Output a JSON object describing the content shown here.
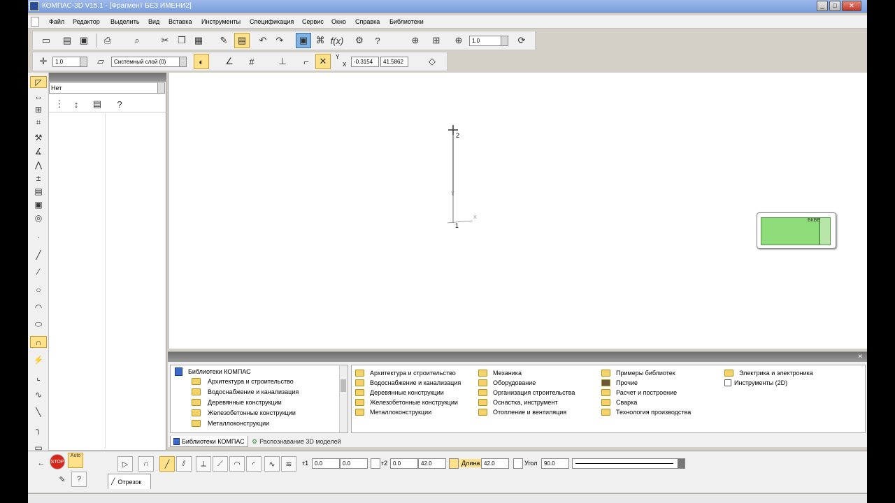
{
  "window": {
    "title": "КОМПАС-3D V15.1 - [Фрагмент БЕЗ ИМЕНИ2]",
    "buttons": [
      "_",
      "□",
      "✕"
    ]
  },
  "menubar": {
    "items": [
      "Файл",
      "Редактор",
      "Выделить",
      "Вид",
      "Вставка",
      "Инструменты",
      "Спецификация",
      "Сервис",
      "Окно",
      "Справка",
      "Библиотеки"
    ]
  },
  "toolbar_standard": {
    "scale_value": "1.0"
  },
  "toolbar_current_state": {
    "step_value": "1.0",
    "layer": "Системный слой (0)",
    "coord_x": "-0.3154",
    "coord_y": "41.5862",
    "coord_label_y": "Y",
    "coord_label_x": "X"
  },
  "tree_panel": {
    "filter": "Нет"
  },
  "canvas": {
    "point_1": "1",
    "point_2": "2",
    "axis_x": "X",
    "axis_y": "Y",
    "nav_label": "БКВЕ"
  },
  "library_panel": {
    "root": "Библиотеки КОМПАС",
    "tree_items": [
      "Архитектура и строительство",
      "Водоснабжение и канализация",
      "Деревянные конструкции",
      "Железобетонные конструкции",
      "Металлоконструкции"
    ],
    "columns": [
      [
        "Архитектура и строительство",
        "Водоснабжение и канализация",
        "Деревянные конструкции",
        "Железобетонные конструкции",
        "Металлоконструкции"
      ],
      [
        "Механика",
        "Оборудование",
        "Организация строительства",
        "Оснастка, инструмент",
        "Отопление и вентиляция"
      ],
      [
        "Примеры библиотек",
        "Прочие",
        "Расчет и построение",
        "Сварка",
        "Технология производства"
      ],
      [
        "Электрика и электроника",
        "Инструменты (2D)"
      ]
    ],
    "tabs": [
      "Библиотеки КОМПАС",
      "Распознавание 3D моделей"
    ]
  },
  "property_bar": {
    "auto_label": "Auto",
    "stop_label": "STOP",
    "t1_label": "т1",
    "t1_x": "0.0",
    "t1_y": "0.0",
    "t2_label": "т2",
    "t2_x": "0.0",
    "t2_y": "42.0",
    "length_label": "Длина",
    "length_value": "42.0",
    "angle_label": "Угол",
    "angle_value": "90.0",
    "tab_label": "Отрезок"
  },
  "colors": {
    "active_button": "#ffe18a",
    "nav_green": "#8fdc7a",
    "folder": "#f4d26a"
  }
}
